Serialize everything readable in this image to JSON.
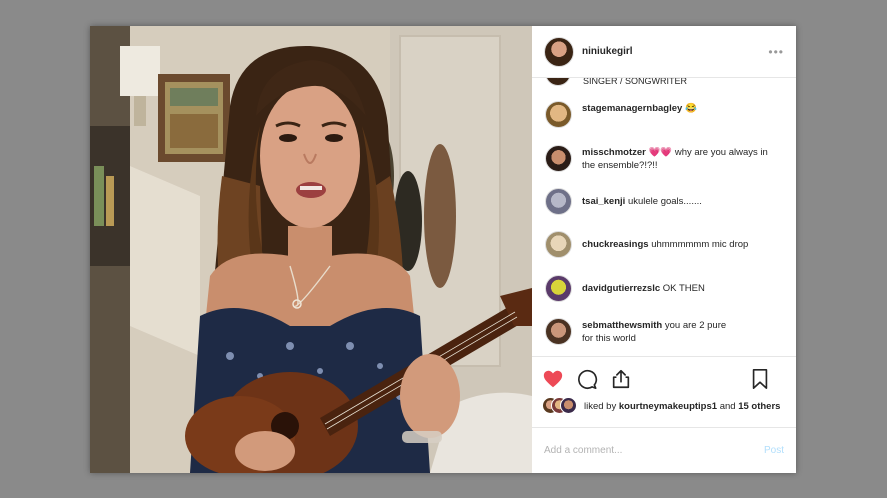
{
  "post": {
    "username": "niniukegirl",
    "more_label": "•••",
    "partial_comment_text": "SINGER / SONGWRITER"
  },
  "comments": [
    {
      "user": "stagemanagernbagley",
      "text": "😂"
    },
    {
      "user": "misschmotzer",
      "text": "💗💗 why are you always in the ensemble?!?!!"
    },
    {
      "user": "tsai_kenji",
      "text": "ukulele goals......."
    },
    {
      "user": "chuckreasings",
      "text": "uhmmmmmm mic drop"
    },
    {
      "user": "davidgutierrezslc",
      "text": "OK THEN"
    },
    {
      "user": "sebmatthewsmith",
      "text": "you are 2 pure for this world"
    }
  ],
  "likes": {
    "prefix": "liked by",
    "user": "kourtneymakeuptips1",
    "joiner": "and",
    "others": "15 others"
  },
  "add_comment": {
    "placeholder": "Add a comment...",
    "post_label": "Post"
  },
  "colors": {
    "heart": "#ed4956",
    "post_disabled": "#b2dffc",
    "background": "#8a8a8a"
  },
  "icons": [
    "heart-icon",
    "comment-icon",
    "share-icon",
    "bookmark-icon"
  ]
}
